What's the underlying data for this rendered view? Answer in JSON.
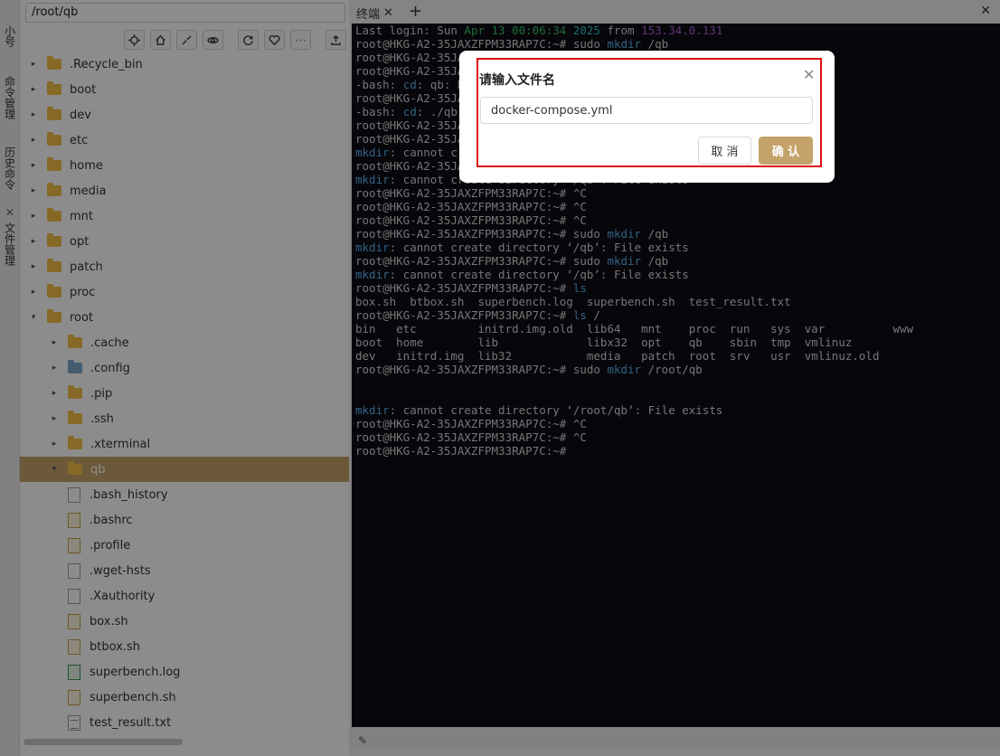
{
  "sidebar_tabs": [
    "小号",
    "命令管理",
    "历史命令",
    "文件管理"
  ],
  "file_manager": {
    "path": "/root/qb",
    "tree": [
      {
        "label": ".Recycle_bin",
        "kind": "folder",
        "depth": 0,
        "arrow": "▸"
      },
      {
        "label": "boot",
        "kind": "folder",
        "depth": 0,
        "arrow": "▸"
      },
      {
        "label": "dev",
        "kind": "folder",
        "depth": 0,
        "arrow": "▸"
      },
      {
        "label": "etc",
        "kind": "folder",
        "depth": 0,
        "arrow": "▸"
      },
      {
        "label": "home",
        "kind": "folder",
        "depth": 0,
        "arrow": "▸"
      },
      {
        "label": "media",
        "kind": "folder",
        "depth": 0,
        "arrow": "▸"
      },
      {
        "label": "mnt",
        "kind": "folder",
        "depth": 0,
        "arrow": "▸"
      },
      {
        "label": "opt",
        "kind": "folder",
        "depth": 0,
        "arrow": "▸"
      },
      {
        "label": "patch",
        "kind": "folder",
        "depth": 0,
        "arrow": "▸"
      },
      {
        "label": "proc",
        "kind": "folder",
        "depth": 0,
        "arrow": "▸"
      },
      {
        "label": "root",
        "kind": "folder",
        "depth": 0,
        "arrow": "▾"
      },
      {
        "label": ".cache",
        "kind": "folder",
        "depth": 1,
        "arrow": "▸"
      },
      {
        "label": ".config",
        "kind": "config",
        "depth": 1,
        "arrow": "▸"
      },
      {
        "label": ".pip",
        "kind": "folder",
        "depth": 1,
        "arrow": "▸"
      },
      {
        "label": ".ssh",
        "kind": "folder",
        "depth": 1,
        "arrow": "▸"
      },
      {
        "label": ".xterminal",
        "kind": "folder",
        "depth": 1,
        "arrow": "▸"
      },
      {
        "label": "qb",
        "kind": "folder",
        "depth": 1,
        "arrow": "▾",
        "selected": true
      },
      {
        "label": ".bash_history",
        "kind": "file",
        "depth": 1
      },
      {
        "label": ".bashrc",
        "kind": "sh",
        "depth": 1
      },
      {
        "label": ".profile",
        "kind": "sh",
        "depth": 1
      },
      {
        "label": ".wget-hsts",
        "kind": "file",
        "depth": 1
      },
      {
        "label": ".Xauthority",
        "kind": "file",
        "depth": 1
      },
      {
        "label": "box.sh",
        "kind": "sh",
        "depth": 1
      },
      {
        "label": "btbox.sh",
        "kind": "sh",
        "depth": 1
      },
      {
        "label": "superbench.log",
        "kind": "log",
        "depth": 1
      },
      {
        "label": "superbench.sh",
        "kind": "sh",
        "depth": 1
      },
      {
        "label": "test_result.txt",
        "kind": "txt",
        "depth": 1
      }
    ]
  },
  "terminal": {
    "tab_label": "终端",
    "lines": [
      [
        [
          "Last login: Sun ",
          ""
        ],
        [
          "Apr 13 00:06:34",
          "green"
        ],
        [
          " ",
          ""
        ],
        [
          "2025",
          "teal"
        ],
        [
          " from ",
          ""
        ],
        [
          "153.34.0.131",
          "purple"
        ]
      ],
      [
        [
          "root@HKG-A2-35JAXZFPM33RAP7C:~# sudo ",
          ""
        ],
        [
          "mkdir",
          "cyan"
        ],
        [
          " /qb",
          ""
        ]
      ],
      [
        [
          "root@HKG-A2-35JAXZFPM33RAP7C:~# ",
          ""
        ]
      ],
      [
        [
          "root@HKG-A2-35JAXZFPM33RAP7C:~# ",
          ""
        ]
      ],
      [
        [
          "-bash: ",
          ""
        ],
        [
          "cd",
          "cyan"
        ],
        [
          ": qb: No such file or directory",
          ""
        ]
      ],
      [
        [
          "root@HKG-A2-35JAXZFPM33RAP7C:~# ",
          ""
        ]
      ],
      [
        [
          "-bash: ",
          ""
        ],
        [
          "cd",
          "cyan"
        ],
        [
          ": ./qb: No such file or directory",
          ""
        ]
      ],
      [
        [
          "root@HKG-A2-35JAXZFPM33RAP7C:~# ",
          ""
        ]
      ],
      [
        [
          "root@HKG-A2-35JAXZFPM33RAP7C:~# ",
          ""
        ]
      ],
      [
        [
          "mkdir",
          "cyan"
        ],
        [
          ": cannot create directory ‘/qb’: File exists",
          ""
        ]
      ],
      [
        [
          "root@HKG-A2-35JAXZFPM33RAP7C:~# ",
          ""
        ]
      ],
      [
        [
          "mkdir",
          "cyan"
        ],
        [
          ": cannot create directory ‘/qb’: File exists",
          ""
        ]
      ],
      [
        [
          "root@HKG-A2-35JAXZFPM33RAP7C:~# ^C",
          ""
        ]
      ],
      [
        [
          "root@HKG-A2-35JAXZFPM33RAP7C:~# ^C",
          ""
        ]
      ],
      [
        [
          "root@HKG-A2-35JAXZFPM33RAP7C:~# ^C",
          ""
        ]
      ],
      [
        [
          "root@HKG-A2-35JAXZFPM33RAP7C:~# sudo ",
          ""
        ],
        [
          "mkdir",
          "cyan"
        ],
        [
          " /qb",
          ""
        ]
      ],
      [
        [
          "mkdir",
          "cyan"
        ],
        [
          ": cannot create directory ‘/qb’: File exists",
          ""
        ]
      ],
      [
        [
          "root@HKG-A2-35JAXZFPM33RAP7C:~# sudo ",
          ""
        ],
        [
          "mkdir",
          "cyan"
        ],
        [
          " /qb",
          ""
        ]
      ],
      [
        [
          "mkdir",
          "cyan"
        ],
        [
          ": cannot create directory ‘/qb’: File exists",
          ""
        ]
      ],
      [
        [
          "root@HKG-A2-35JAXZFPM33RAP7C:~# ",
          ""
        ],
        [
          "ls",
          "cyan"
        ]
      ],
      [
        [
          "box.sh  btbox.sh  superbench.log  superbench.sh  test_result.txt",
          ""
        ]
      ],
      [
        [
          "root@HKG-A2-35JAXZFPM33RAP7C:~# ",
          ""
        ],
        [
          "ls",
          "cyan"
        ],
        [
          " /",
          ""
        ]
      ],
      [
        [
          "bin   etc         initrd.img.old  lib64   mnt    proc  run   sys  var          www",
          ""
        ]
      ],
      [
        [
          "boot  home        lib             libx32  opt    qb    sbin  tmp  vmlinuz",
          ""
        ]
      ],
      [
        [
          "dev   initrd.img  lib32           media   patch  root  srv   usr  vmlinuz.old",
          ""
        ]
      ],
      [
        [
          "root@HKG-A2-35JAXZFPM33RAP7C:~# sudo ",
          ""
        ],
        [
          "mkdir",
          "cyan"
        ],
        [
          " /root/qb",
          ""
        ]
      ],
      [
        [
          "",
          ""
        ]
      ],
      [
        [
          "",
          ""
        ]
      ],
      [
        [
          "mkdir",
          "cyan"
        ],
        [
          ": cannot create directory ‘/root/qb’: File exists",
          ""
        ]
      ],
      [
        [
          "root@HKG-A2-35JAXZFPM33RAP7C:~# ^C",
          ""
        ]
      ],
      [
        [
          "root@HKG-A2-35JAXZFPM33RAP7C:~# ^C",
          ""
        ]
      ],
      [
        [
          "root@HKG-A2-35JAXZFPM33RAP7C:~# ",
          ""
        ]
      ]
    ]
  },
  "dialog": {
    "title": "请输入文件名",
    "input_value": "docker-compose.yml",
    "cancel_label": "取 消",
    "ok_label": "确 认"
  },
  "colors": {
    "accent": "#c3a36a",
    "highlight_box": "#e01010",
    "terminal_bg": "#0c0c14"
  }
}
